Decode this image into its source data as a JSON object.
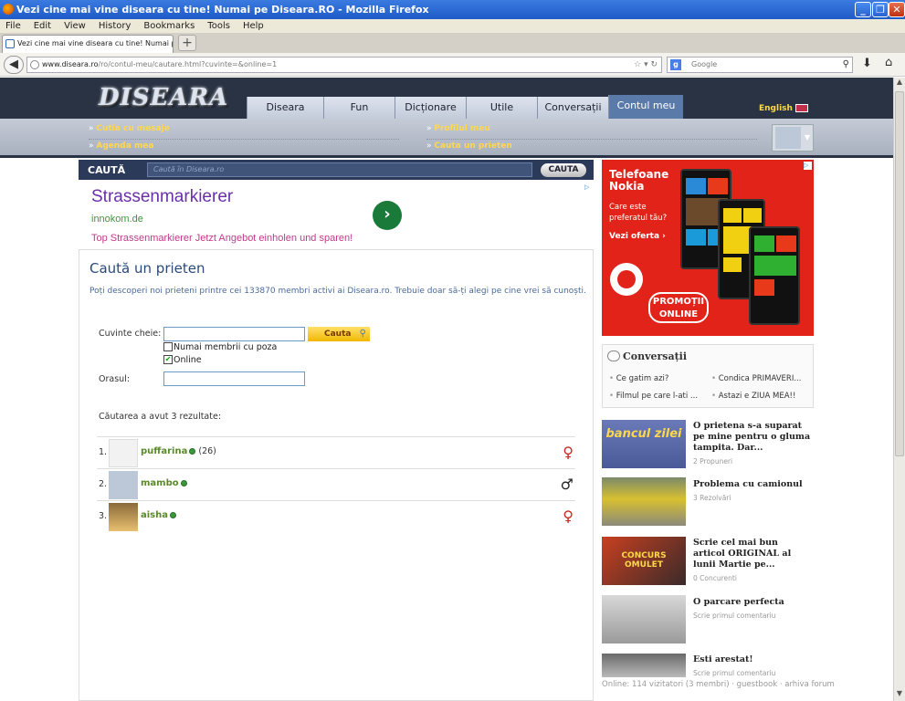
{
  "window": {
    "title": "Vezi cine mai vine diseara cu tine! Numai pe Diseara.RO - Mozilla Firefox"
  },
  "menu": [
    "File",
    "Edit",
    "View",
    "History",
    "Bookmarks",
    "Tools",
    "Help"
  ],
  "tab": {
    "title": "Vezi cine mai vine diseara cu tine! Numai pe ...",
    "new_tab": "+"
  },
  "nav": {
    "url_domain": "www.diseara.ro",
    "url_path": "/ro/contul-meu/cautare.html?cuvinte=&online=1",
    "search_placeholder": "Google"
  },
  "site": {
    "logo": "DISEARA",
    "tabs": [
      "Diseara",
      "Fun",
      "Dicționare",
      "Utile",
      "Conversații",
      "Contul meu"
    ],
    "active_tab": "Contul meu",
    "language": "English",
    "sublinks": [
      "Cutia cu mesaje",
      "Agenda mea",
      "Profilul meu",
      "Cauta un prieten"
    ]
  },
  "searchbar": {
    "label": "CAUTĂ",
    "placeholder": "Caută în Diseara.ro",
    "button": "CAUTA"
  },
  "ad": {
    "title": "Strassenmarkierer",
    "domain": "innokom.de",
    "description": "Top Strassenmarkierer Jetzt Angebot einholen und sparen!",
    "go": "›",
    "choice": "▷"
  },
  "main": {
    "title": "Caută un prieten",
    "intro": "Poți descoperi noi prieteni printre cei 133870 membri activi ai Diseara.ro. Trebuie doar să-ți alegi pe cine vrei să cunoști.",
    "keywords_label": "Cuvinte cheie:",
    "keywords_value": "",
    "search_button": "Cauta",
    "only_photo_label": "Numai membrii cu poza",
    "only_photo_checked": false,
    "online_label": "Online",
    "online_checked": true,
    "city_label": "Orasul:",
    "city_value": "",
    "results_text": "Căutarea a avut 3 rezultate:",
    "results": [
      {
        "num": "1.",
        "name": "puffarina",
        "count": "(26)",
        "gender": "♀",
        "gender_color": "#c8281e"
      },
      {
        "num": "2.",
        "name": "mambo",
        "count": "",
        "gender": "♂",
        "gender_color": "#222222"
      },
      {
        "num": "3.",
        "name": "aisha",
        "count": "",
        "gender": "♀",
        "gender_color": "#c8281e"
      }
    ]
  },
  "nokia_ad": {
    "title": "Telefoane Nokia",
    "question": "Care este preferatul tău?",
    "cta": "Vezi oferta ›",
    "promo": "PROMOȚII ONLINE",
    "choice": "▷"
  },
  "conversatii": {
    "title": "Conversații",
    "items": [
      "Ce gatim azi?",
      "Condica PRIMAVERI...",
      "Filmul pe care l-ati ...",
      "Astazi e ZIUA MEA!!"
    ]
  },
  "side_items": [
    {
      "title": "O prietena s-a suparat pe mine pentru o gluma tampita. Dar...",
      "sub": "2 Propuneri",
      "thumb": "bancul zilei"
    },
    {
      "title": "Problema cu camionul",
      "sub": "3 Rezolvări",
      "thumb": "truck"
    },
    {
      "title": "Scrie cel mai bun articol ORIGINAL al lunii Martie pe...",
      "sub": "0 Concurenti",
      "thumb": "concurs omulet"
    },
    {
      "title": "O parcare perfecta",
      "sub": "Scrie primul comentariu",
      "thumb": "parking"
    },
    {
      "title": "Esti arestat!",
      "sub": "Scrie primul comentariu",
      "thumb": "arrest"
    }
  ],
  "footer": "Online: 114 vizitatori (3 membri) · guestbook · arhiva forum",
  "colors": {
    "header": "#2a3344",
    "accent_yellow": "#ffd84a",
    "link_green": "#5a8a2a",
    "nokia_red": "#e2231a"
  }
}
